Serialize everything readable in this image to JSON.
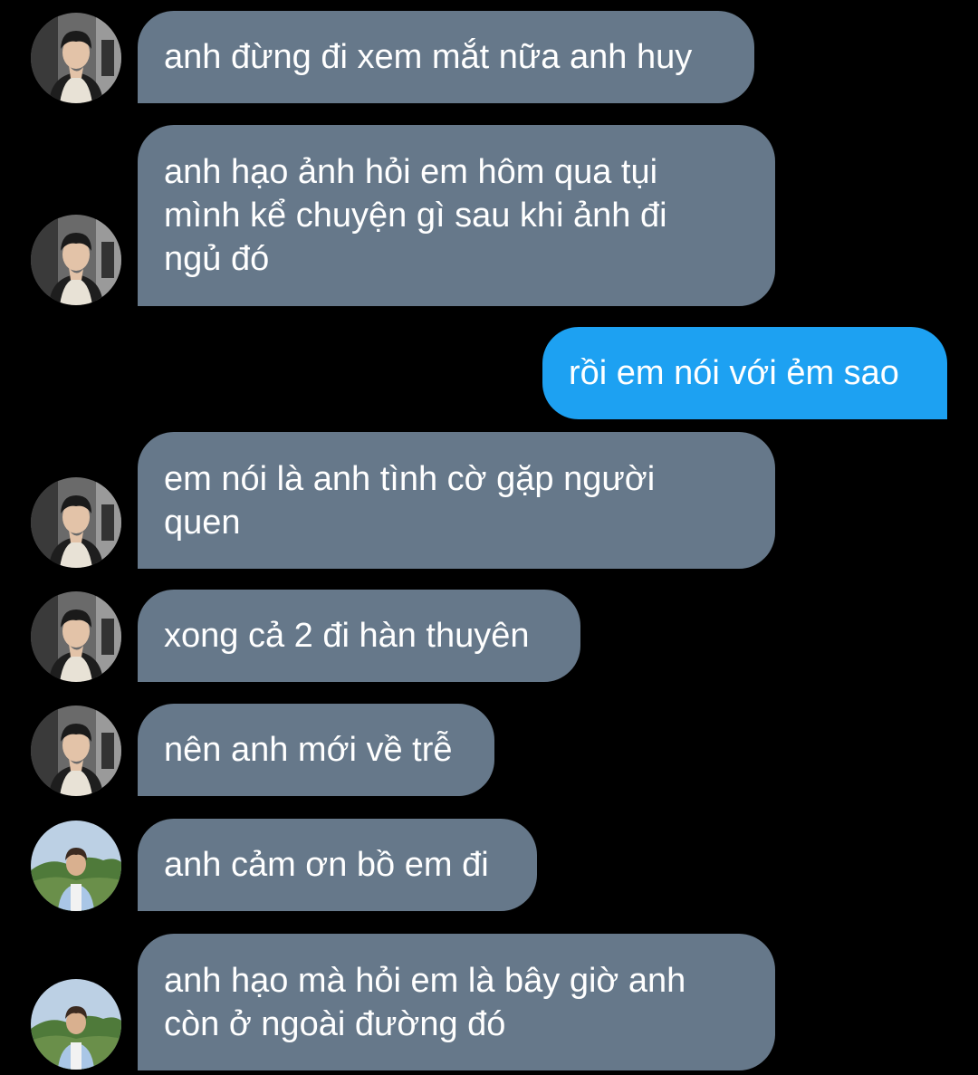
{
  "messages": [
    {
      "direction": "in",
      "text": "anh đừng đi xem mắt nữa anh huy",
      "avatar": "avatar-dark-hoodie"
    },
    {
      "direction": "in",
      "text": "anh hạo ảnh hỏi em hôm qua tụi\nmình kể chuyện gì sau khi ảnh đi\nngủ đó",
      "avatar": "avatar-dark-hoodie"
    },
    {
      "direction": "out",
      "text": "rồi em nói với ẻm sao"
    },
    {
      "direction": "in",
      "text": "em nói là anh tình cờ gặp người\nquen",
      "avatar": "avatar-dark-hoodie"
    },
    {
      "direction": "in",
      "text": "xong cả 2 đi hàn thuyên",
      "avatar": "avatar-dark-hoodie"
    },
    {
      "direction": "in",
      "text": "nên anh mới về trễ",
      "avatar": "avatar-dark-hoodie"
    },
    {
      "direction": "in",
      "text": "anh cảm ơn bồ em đi",
      "avatar": "avatar-outdoor-green"
    },
    {
      "direction": "in",
      "text": "anh hạo mà hỏi em là bây giờ anh\ncòn ở ngoài đường đó",
      "avatar": "avatar-outdoor-green"
    }
  ],
  "colors": {
    "background": "#000000",
    "incoming_bubble": "#66788a",
    "outgoing_bubble": "#1da1f2",
    "text": "#ffffff"
  }
}
